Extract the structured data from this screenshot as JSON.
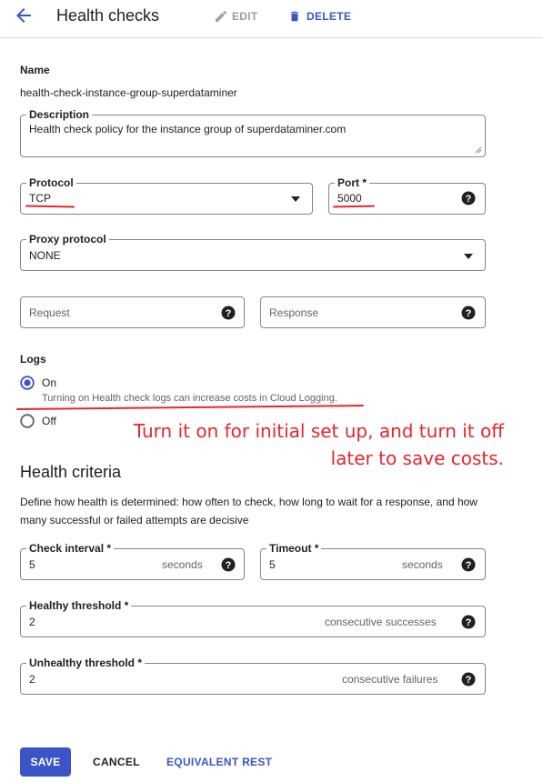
{
  "header": {
    "title": "Health checks",
    "edit_label": "EDIT",
    "delete_label": "DELETE",
    "accent_color": "#3b55c7"
  },
  "form": {
    "name_label": "Name",
    "name_value": "health-check-instance-group-superdataminer",
    "description_label": "Description",
    "description_value": "Health check policy for the instance group of superdataminer.com",
    "protocol_label": "Protocol",
    "protocol_value": "TCP",
    "port_label": "Port *",
    "port_value": "5000",
    "proxy_label": "Proxy protocol",
    "proxy_value": "NONE",
    "request_placeholder": "Request",
    "response_placeholder": "Response"
  },
  "logs": {
    "label": "Logs",
    "on_label": "On",
    "on_hint": "Turning on Health check logs can increase costs in Cloud Logging.",
    "off_label": "Off",
    "selected": "On"
  },
  "annotation": {
    "lines": [
      "Turn it on for initial set up, and turn it off",
      "later to save costs."
    ],
    "color": "#e8262c"
  },
  "health_criteria": {
    "title": "Health criteria",
    "description": "Define how health is determined: how often to check, how long to wait for a response, and how many successful or failed attempts are decisive",
    "check_interval": {
      "label": "Check interval *",
      "value": "5",
      "unit": "seconds"
    },
    "timeout": {
      "label": "Timeout *",
      "value": "5",
      "unit": "seconds"
    },
    "healthy_threshold": {
      "label": "Healthy threshold *",
      "value": "2",
      "unit": "consecutive successes"
    },
    "unhealthy_threshold": {
      "label": "Unhealthy threshold *",
      "value": "2",
      "unit": "consecutive failures"
    }
  },
  "footer": {
    "save_label": "SAVE",
    "cancel_label": "CANCEL",
    "rest_label": "EQUIVALENT REST"
  }
}
